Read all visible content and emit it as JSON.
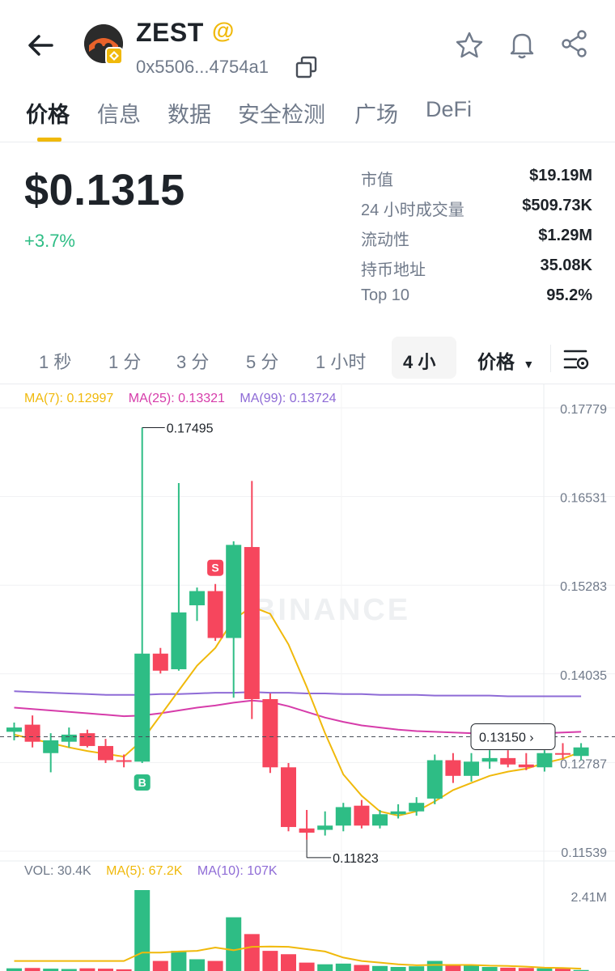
{
  "header": {
    "token_name": "ZEST",
    "address": "0x5506...4754a1"
  },
  "tabs": [
    "价格",
    "信息",
    "数据",
    "安全检测",
    "广场",
    "DeFi"
  ],
  "price": {
    "value": "$0.1315",
    "change": "+3.7%"
  },
  "stats": [
    {
      "label": "市值",
      "value": "$19.19M"
    },
    {
      "label": "24 小时成交量",
      "value": "$509.73K"
    },
    {
      "label": "流动性",
      "value": "$1.29M"
    },
    {
      "label": "持币地址",
      "value": "35.08K"
    },
    {
      "label": "Top 10",
      "value": "95.2%"
    }
  ],
  "intervals": [
    "1 秒",
    "1 分",
    "3 分",
    "5 分",
    "1 小时",
    "4 小"
  ],
  "active_interval": 5,
  "price_select": "价格",
  "colors": {
    "up": "#2ebd85",
    "down": "#f6465d",
    "ma7": "#f0b90b",
    "ma25": "#d63caa",
    "ma99": "#8e6bd6",
    "accent": "#f0b90b"
  },
  "ma_legend": {
    "ma7": "MA(7): 0.12997",
    "ma25": "MA(25): 0.13321",
    "ma99": "MA(99): 0.13724"
  },
  "vol_legend": {
    "vol": "VOL: 30.4K",
    "ma5": "MA(5): 67.2K",
    "ma10": "MA(10): 107K"
  },
  "watermark": "BINANCE",
  "markers": {
    "buy": "B",
    "sell": "S"
  },
  "chart_data": {
    "type": "candlestick",
    "y_ticks": [
      "0.17779",
      "0.16531",
      "0.15283",
      "0.14035",
      "0.12787",
      "0.11539"
    ],
    "ylim": [
      0.11539,
      0.17779
    ],
    "high_label": "0.17495",
    "low_label": "0.11823",
    "current_price_label": "0.13150",
    "current_price": 0.1315,
    "volume_tick": "2.41M",
    "candles": [
      {
        "o": 0.1322,
        "h": 0.1335,
        "l": 0.131,
        "c": 0.1328
      },
      {
        "o": 0.1332,
        "h": 0.1345,
        "l": 0.13,
        "c": 0.1308
      },
      {
        "o": 0.1292,
        "h": 0.132,
        "l": 0.1265,
        "c": 0.131
      },
      {
        "o": 0.1308,
        "h": 0.1328,
        "l": 0.13,
        "c": 0.1318
      },
      {
        "o": 0.132,
        "h": 0.1325,
        "l": 0.13,
        "c": 0.1302
      },
      {
        "o": 0.1302,
        "h": 0.1312,
        "l": 0.1278,
        "c": 0.1282
      },
      {
        "o": 0.1282,
        "h": 0.129,
        "l": 0.1272,
        "c": 0.128
      },
      {
        "o": 0.128,
        "h": 0.175,
        "l": 0.1278,
        "c": 0.1432
      },
      {
        "o": 0.1432,
        "h": 0.144,
        "l": 0.1404,
        "c": 0.1408
      },
      {
        "o": 0.141,
        "h": 0.1672,
        "l": 0.1408,
        "c": 0.149
      },
      {
        "o": 0.15,
        "h": 0.1525,
        "l": 0.1478,
        "c": 0.152
      },
      {
        "o": 0.152,
        "h": 0.153,
        "l": 0.145,
        "c": 0.1454
      },
      {
        "o": 0.1454,
        "h": 0.159,
        "l": 0.137,
        "c": 0.1585
      },
      {
        "o": 0.1582,
        "h": 0.1675,
        "l": 0.134,
        "c": 0.1368
      },
      {
        "o": 0.1368,
        "h": 0.1376,
        "l": 0.1264,
        "c": 0.1272
      },
      {
        "o": 0.1272,
        "h": 0.1278,
        "l": 0.1182,
        "c": 0.1188
      },
      {
        "o": 0.1186,
        "h": 0.1212,
        "l": 0.117,
        "c": 0.118
      },
      {
        "o": 0.1184,
        "h": 0.121,
        "l": 0.1176,
        "c": 0.119
      },
      {
        "o": 0.119,
        "h": 0.1222,
        "l": 0.1182,
        "c": 0.1216
      },
      {
        "o": 0.1218,
        "h": 0.1226,
        "l": 0.1186,
        "c": 0.119
      },
      {
        "o": 0.119,
        "h": 0.1212,
        "l": 0.1186,
        "c": 0.1206
      },
      {
        "o": 0.1206,
        "h": 0.122,
        "l": 0.12,
        "c": 0.121
      },
      {
        "o": 0.121,
        "h": 0.123,
        "l": 0.1204,
        "c": 0.1222
      },
      {
        "o": 0.1228,
        "h": 0.129,
        "l": 0.122,
        "c": 0.1282
      },
      {
        "o": 0.1282,
        "h": 0.1292,
        "l": 0.125,
        "c": 0.126
      },
      {
        "o": 0.126,
        "h": 0.1292,
        "l": 0.1252,
        "c": 0.128
      },
      {
        "o": 0.128,
        "h": 0.1296,
        "l": 0.127,
        "c": 0.1285
      },
      {
        "o": 0.1285,
        "h": 0.1296,
        "l": 0.1272,
        "c": 0.1276
      },
      {
        "o": 0.1276,
        "h": 0.1292,
        "l": 0.1268,
        "c": 0.1272
      },
      {
        "o": 0.1272,
        "h": 0.1296,
        "l": 0.1266,
        "c": 0.1292
      },
      {
        "o": 0.1292,
        "h": 0.1306,
        "l": 0.1284,
        "c": 0.129
      },
      {
        "o": 0.1288,
        "h": 0.1306,
        "l": 0.1282,
        "c": 0.13
      }
    ],
    "ma7": [
      0.1318,
      0.1312,
      0.1306,
      0.13,
      0.1295,
      0.1291,
      0.1287,
      0.131,
      0.1345,
      0.138,
      0.1415,
      0.144,
      0.148,
      0.1498,
      0.1488,
      0.1445,
      0.1385,
      0.132,
      0.1262,
      0.1232,
      0.121,
      0.1204,
      0.121,
      0.1224,
      0.124,
      0.125,
      0.126,
      0.1266,
      0.127,
      0.1278,
      0.1284,
      0.1294
    ],
    "ma25": [
      0.1356,
      0.1354,
      0.1352,
      0.135,
      0.1348,
      0.1346,
      0.1344,
      0.1345,
      0.1348,
      0.1352,
      0.1356,
      0.1359,
      0.1363,
      0.1366,
      0.1364,
      0.1358,
      0.135,
      0.1342,
      0.1336,
      0.1331,
      0.1328,
      0.1325,
      0.1323,
      0.1322,
      0.1321,
      0.132,
      0.132,
      0.132,
      0.132,
      0.132,
      0.1321,
      0.1322
    ],
    "ma99": [
      0.1379,
      0.1378,
      0.1377,
      0.1376,
      0.1375,
      0.1374,
      0.1374,
      0.1374,
      0.1375,
      0.1375,
      0.1376,
      0.1377,
      0.1377,
      0.1378,
      0.1377,
      0.1377,
      0.1376,
      0.1376,
      0.1375,
      0.1375,
      0.1374,
      0.1374,
      0.1374,
      0.1373,
      0.1373,
      0.1373,
      0.1373,
      0.1372,
      0.1372,
      0.1372,
      0.1372,
      0.1372
    ],
    "volumes": [
      0.08,
      0.09,
      0.07,
      0.06,
      0.08,
      0.07,
      0.05,
      2.41,
      0.3,
      0.6,
      0.35,
      0.3,
      1.6,
      1.1,
      0.6,
      0.5,
      0.25,
      0.2,
      0.22,
      0.18,
      0.15,
      0.12,
      0.14,
      0.3,
      0.2,
      0.18,
      0.12,
      0.1,
      0.09,
      0.08,
      0.07,
      0.03
    ],
    "vol_ma5": [
      0.3,
      0.3,
      0.3,
      0.3,
      0.3,
      0.3,
      0.3,
      0.55,
      0.55,
      0.58,
      0.6,
      0.7,
      0.62,
      0.72,
      0.73,
      0.72,
      0.65,
      0.58,
      0.4,
      0.3,
      0.25,
      0.2,
      0.17,
      0.18,
      0.18,
      0.18,
      0.16,
      0.15,
      0.13,
      0.1,
      0.09,
      0.07
    ]
  }
}
